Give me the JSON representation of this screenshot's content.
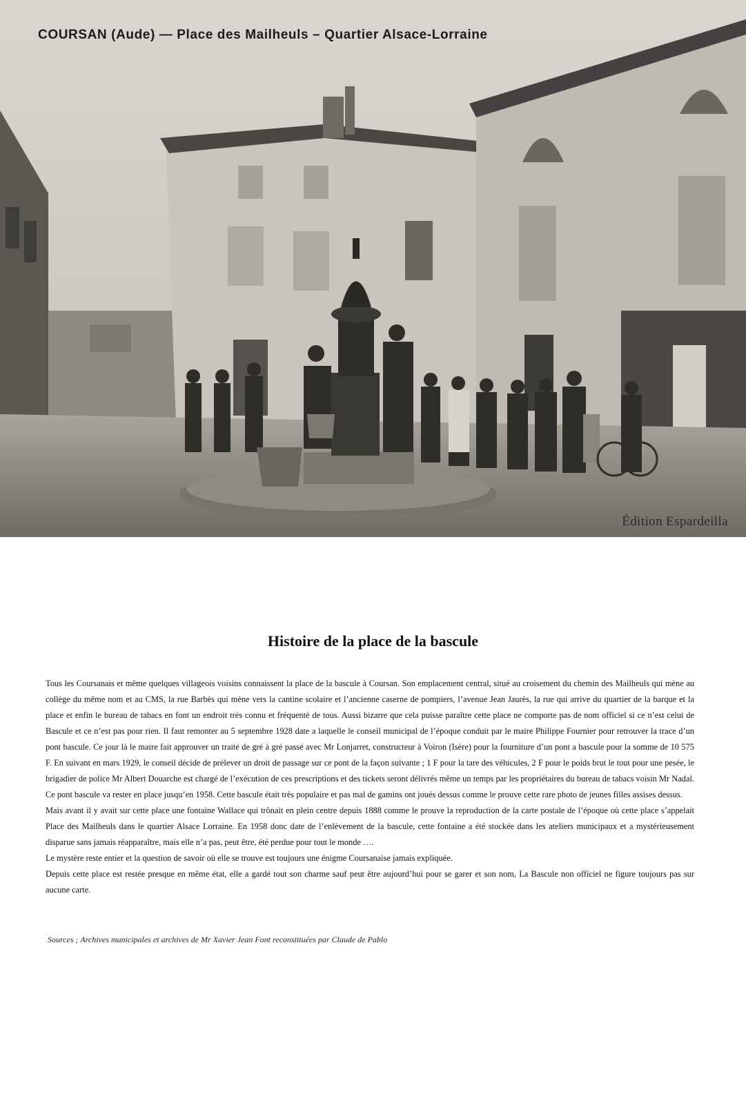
{
  "photo": {
    "caption": "COURSAN (Aude) — Place des Mailheuls – Quartier Alsace-Lorraine",
    "publisher": "Édition Espardeilla"
  },
  "article": {
    "title": "Histoire de la place de la bascule",
    "paragraphs": [
      "Tous les Coursanais et même quelques villageois voisins connaissent la place de la bascule à Coursan. Son emplacement central, situé au croisement du chemin des Mailheuls qui mène au collège du même nom et au CMS, la rue Barbès qui mène vers la cantine scolaire et l’ancienne caserne de pompiers, l’avenue Jean Jaurès, la rue qui arrive du quartier de la barque et la place et enfin le bureau de tabacs en font un endroit très connu et fréquenté de tous. Aussi bizarre que cela puisse paraître cette place ne comporte pas de nom officiel si ce n’est celui de Bascule et ce n’est pas pour rien. Il faut remonter au 5 septembre 1928 date a laquelle le conseil municipal de l’époque conduit par le maire Philippe Fournier pour retrouver la trace d’un pont bascule. Ce jour là le maire fait approuver un traité de gré à gré passé avec Mr Lonjarret, constructeur à Voiron (Isère) pour la fourniture d’un pont a bascule pour la somme de 10 575 F. En suivant en mars 1929, le conseil décide de prélever un droit de passage sur ce pont de la façon suivante ; 1 F pour la tare des véhicules, 2 F pour le poids brut le tout pour une pesée, le brigadier de police Mr Albert Douarche est chargé de l’exécution de ces prescriptions et des tickets seront délivrés même un temps par les propriétaires du bureau de tabacs voisin Mr Nadal. Ce pont bascule va rester en place jusqu’en 1958. Cette bascule était très populaire et pas mal de gamins ont joués dessus comme le prouve cette rare photo de jeunes filles assises dessus.",
      "Mais avant il y avait sur cette place une fontaine Wallace qui trônait en plein centre depuis 1888 comme le prouve la reproduction de la carte postale de l’époque où cette place s’appelait Place des Mailheuls dans le quartier Alsace Lorraine. En 1958 donc date de l’enlèvement de la bascule, cette fontaine a été stockée dans les ateliers municipaux et a mystérieusement disparue sans jamais réapparaître, mais elle n’a pas, peut être, été perdue pour tout le monde ….",
      "Le mystère reste entier et la question de savoir où elle se trouve est toujours une énigme Coursanaise jamais expliquée.",
      "Depuis cette place est restée presque en même état, elle a gardé tout son charme sauf peut être aujourd’hui pour se garer et son nom, La Bascule non officiel ne figure toujours pas sur aucune carte."
    ],
    "sources": "Sources ; Archives municipales et archives de Mr Xavier Jean Font reconstituées par Claude de Pablo"
  }
}
